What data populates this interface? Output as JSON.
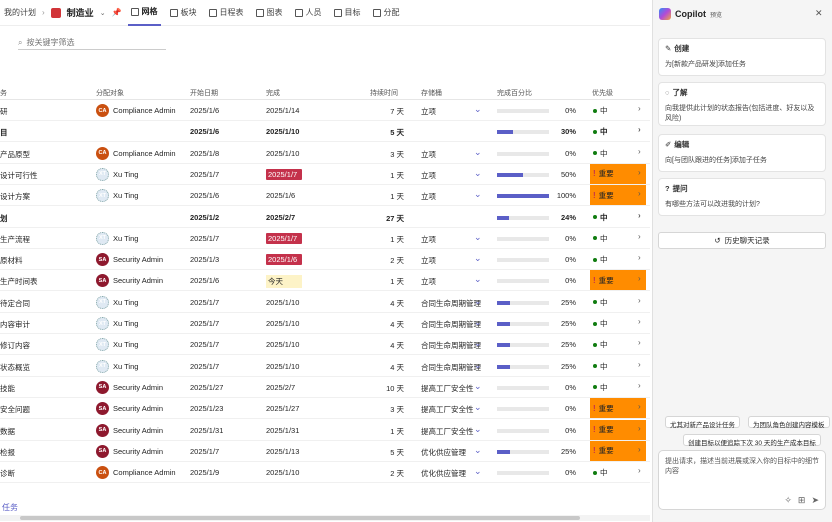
{
  "header": {
    "breadcrumb": "我的计划",
    "project_name": "制造业",
    "tabs": [
      {
        "label": "网格",
        "active": true
      },
      {
        "label": "板块",
        "active": false
      },
      {
        "label": "日程表",
        "active": false
      },
      {
        "label": "图表",
        "active": false
      },
      {
        "label": "人员",
        "active": false
      },
      {
        "label": "目标",
        "active": false
      },
      {
        "label": "分配",
        "active": false
      }
    ]
  },
  "filter": {
    "placeholder": "按关键字筛选"
  },
  "columns": [
    "务",
    "分配对象",
    "开始日期",
    "完成",
    "持续时间",
    "存储桶",
    "完成百分比",
    "优先级"
  ],
  "rows": [
    {
      "name": "研",
      "assignee": "Compliance Admin",
      "avatar": "CA",
      "start": "2025/1/6",
      "due": "2025/1/14",
      "due_style": "",
      "duration": "7 天",
      "bucket": "立项",
      "bucket_chev": true,
      "pct": "0%",
      "pct_value": 0,
      "priority": "中",
      "urgent": false,
      "group": false
    },
    {
      "name": "目",
      "assignee": "",
      "avatar": "",
      "start": "2025/1/6",
      "due": "2025/1/10",
      "due_style": "",
      "duration": "5 天",
      "bucket": "",
      "bucket_chev": false,
      "pct": "30%",
      "pct_value": 30,
      "priority": "中",
      "urgent": false,
      "group": true
    },
    {
      "name": "产品原型",
      "assignee": "Compliance Admin",
      "avatar": "CA",
      "start": "2025/1/8",
      "due": "2025/1/10",
      "due_style": "",
      "duration": "3 天",
      "bucket": "立项",
      "bucket_chev": true,
      "pct": "0%",
      "pct_value": 0,
      "priority": "中",
      "urgent": false,
      "group": false
    },
    {
      "name": "设计可行性",
      "assignee": "Xu Ting",
      "avatar": "XT",
      "start": "2025/1/7",
      "due": "2025/1/7",
      "due_style": "red",
      "duration": "1 天",
      "bucket": "立项",
      "bucket_chev": true,
      "pct": "50%",
      "pct_value": 50,
      "priority": "重要",
      "urgent": true,
      "group": false
    },
    {
      "name": "设计方案",
      "assignee": "Xu Ting",
      "avatar": "XT",
      "start": "2025/1/6",
      "due": "2025/1/6",
      "due_style": "",
      "duration": "1 天",
      "bucket": "立项",
      "bucket_chev": true,
      "pct": "100%",
      "pct_value": 100,
      "priority": "重要",
      "urgent": true,
      "group": false
    },
    {
      "name": "划",
      "assignee": "",
      "avatar": "",
      "start": "2025/1/2",
      "due": "2025/2/7",
      "due_style": "",
      "duration": "27 天",
      "bucket": "",
      "bucket_chev": false,
      "pct": "24%",
      "pct_value": 24,
      "priority": "中",
      "urgent": false,
      "group": true
    },
    {
      "name": "生产流程",
      "assignee": "Xu Ting",
      "avatar": "XT",
      "start": "2025/1/7",
      "due": "2025/1/7",
      "due_style": "red",
      "duration": "1 天",
      "bucket": "立项",
      "bucket_chev": true,
      "pct": "0%",
      "pct_value": 0,
      "priority": "中",
      "urgent": false,
      "group": false
    },
    {
      "name": "原材料",
      "assignee": "Security Admin",
      "avatar": "SA",
      "start": "2025/1/3",
      "due": "2025/1/6",
      "due_style": "red",
      "duration": "2 天",
      "bucket": "立项",
      "bucket_chev": true,
      "pct": "0%",
      "pct_value": 0,
      "priority": "中",
      "urgent": false,
      "group": false
    },
    {
      "name": "生产时间表",
      "assignee": "Security Admin",
      "avatar": "SA",
      "start": "2025/1/6",
      "due": "今天",
      "due_style": "yellow",
      "duration": "1 天",
      "bucket": "立项",
      "bucket_chev": true,
      "pct": "0%",
      "pct_value": 0,
      "priority": "重要",
      "urgent": true,
      "group": false
    },
    {
      "name": "待定合同",
      "assignee": "Xu Ting",
      "avatar": "XT",
      "start": "2025/1/7",
      "due": "2025/1/10",
      "due_style": "",
      "duration": "4 天",
      "bucket": "合同生命周期管理",
      "bucket_chev": true,
      "pct": "25%",
      "pct_value": 25,
      "priority": "中",
      "urgent": false,
      "group": false
    },
    {
      "name": "内容审计",
      "assignee": "Xu Ting",
      "avatar": "XT",
      "start": "2025/1/7",
      "due": "2025/1/10",
      "due_style": "",
      "duration": "4 天",
      "bucket": "合同生命周期管理",
      "bucket_chev": true,
      "pct": "25%",
      "pct_value": 25,
      "priority": "中",
      "urgent": false,
      "group": false
    },
    {
      "name": "修订内容",
      "assignee": "Xu Ting",
      "avatar": "XT",
      "start": "2025/1/7",
      "due": "2025/1/10",
      "due_style": "",
      "duration": "4 天",
      "bucket": "合同生命周期管理",
      "bucket_chev": true,
      "pct": "25%",
      "pct_value": 25,
      "priority": "中",
      "urgent": false,
      "group": false
    },
    {
      "name": "状态概览",
      "assignee": "Xu Ting",
      "avatar": "XT",
      "start": "2025/1/7",
      "due": "2025/1/10",
      "due_style": "",
      "duration": "4 天",
      "bucket": "合同生命周期管理",
      "bucket_chev": true,
      "pct": "25%",
      "pct_value": 25,
      "priority": "中",
      "urgent": false,
      "group": false
    },
    {
      "name": "技能",
      "assignee": "Security Admin",
      "avatar": "SA",
      "start": "2025/1/27",
      "due": "2025/2/7",
      "due_style": "",
      "duration": "10 天",
      "bucket": "提高工厂安全性",
      "bucket_chev": true,
      "pct": "0%",
      "pct_value": 0,
      "priority": "中",
      "urgent": false,
      "group": false
    },
    {
      "name": "安全问题",
      "assignee": "Security Admin",
      "avatar": "SA",
      "start": "2025/1/23",
      "due": "2025/1/27",
      "due_style": "",
      "duration": "3 天",
      "bucket": "提高工厂安全性",
      "bucket_chev": true,
      "pct": "0%",
      "pct_value": 0,
      "priority": "重要",
      "urgent": true,
      "group": false
    },
    {
      "name": "数据",
      "assignee": "Security Admin",
      "avatar": "SA",
      "start": "2025/1/31",
      "due": "2025/1/31",
      "due_style": "",
      "duration": "1 天",
      "bucket": "提高工厂安全性",
      "bucket_chev": true,
      "pct": "0%",
      "pct_value": 0,
      "priority": "重要",
      "urgent": true,
      "group": false
    },
    {
      "name": "检报",
      "assignee": "Security Admin",
      "avatar": "SA",
      "start": "2025/1/7",
      "due": "2025/1/13",
      "due_style": "",
      "duration": "5 天",
      "bucket": "优化供应管理",
      "bucket_chev": true,
      "pct": "25%",
      "pct_value": 25,
      "priority": "重要",
      "urgent": true,
      "group": false
    },
    {
      "name": "诊断",
      "assignee": "Compliance Admin",
      "avatar": "CA",
      "start": "2025/1/9",
      "due": "2025/1/10",
      "due_style": "",
      "duration": "2 天",
      "bucket": "优化供应管理",
      "bucket_chev": true,
      "pct": "0%",
      "pct_value": 0,
      "priority": "中",
      "urgent": false,
      "group": false
    }
  ],
  "add_task": "任务",
  "copilot": {
    "title": "Copilot",
    "badge": "预览",
    "cards": [
      {
        "title": "创建",
        "text": "为[新款产品研发]添加任务",
        "icon": "edit-sparkle-icon"
      },
      {
        "title": "了解",
        "text": "向我提供此计划的状态报告(包括进度、好友以及风险)",
        "icon": "lightbulb-icon"
      },
      {
        "title": "编辑",
        "text": "向[与团队跟进的任务]添加子任务",
        "icon": "pencil-icon"
      },
      {
        "title": "提问",
        "text": "有哪些方法可以改进我的计划?",
        "icon": "question-chat-icon"
      }
    ],
    "history_label": "历史聊天记录",
    "suggestions": [
      "尤其对新产品设计任务",
      "为团队角色创建内容模板",
      "创建目标以便追踪下次 30 天的生产成本目标"
    ],
    "compose_placeholder": "提出请求，描述当前进展或深入你的目标中的细节内容"
  }
}
